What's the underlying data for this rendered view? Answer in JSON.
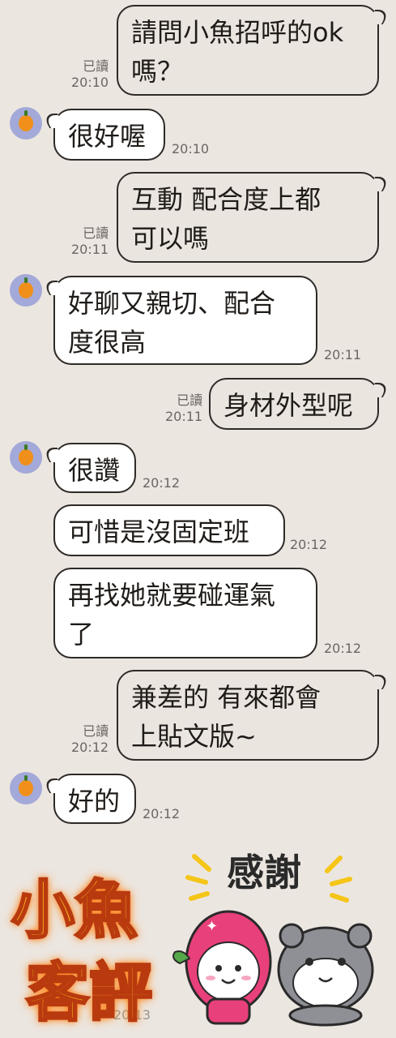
{
  "read_label": "已讀",
  "messages": [
    {
      "side": "out",
      "text": "請問小魚招呼的ok\n嗎？",
      "time": "20:10"
    },
    {
      "side": "in",
      "text": "很好喔",
      "time": "20:10"
    },
    {
      "side": "out",
      "text": "互動 配合度上都\n可以嗎",
      "time": "20:11"
    },
    {
      "side": "in",
      "text": "好聊又親切、配合\n度很高",
      "time": "20:11"
    },
    {
      "side": "out",
      "text": "身材外型呢",
      "time": "20:11"
    },
    {
      "side": "in",
      "text": "很讚",
      "time": "20:12"
    },
    {
      "side": "in",
      "text": "可惜是沒固定班",
      "time": "20:12"
    },
    {
      "side": "in",
      "text": "再找她就要碰運氣\n了",
      "time": "20:12"
    },
    {
      "side": "out",
      "text": "兼差的 有來都會\n上貼文版~",
      "time": "20:12"
    },
    {
      "side": "in",
      "text": "好的",
      "time": "20:12"
    }
  ],
  "sticker": {
    "caption": "感謝",
    "time": "20:13"
  },
  "watermark": {
    "line1": "小魚",
    "line2": "客評"
  }
}
